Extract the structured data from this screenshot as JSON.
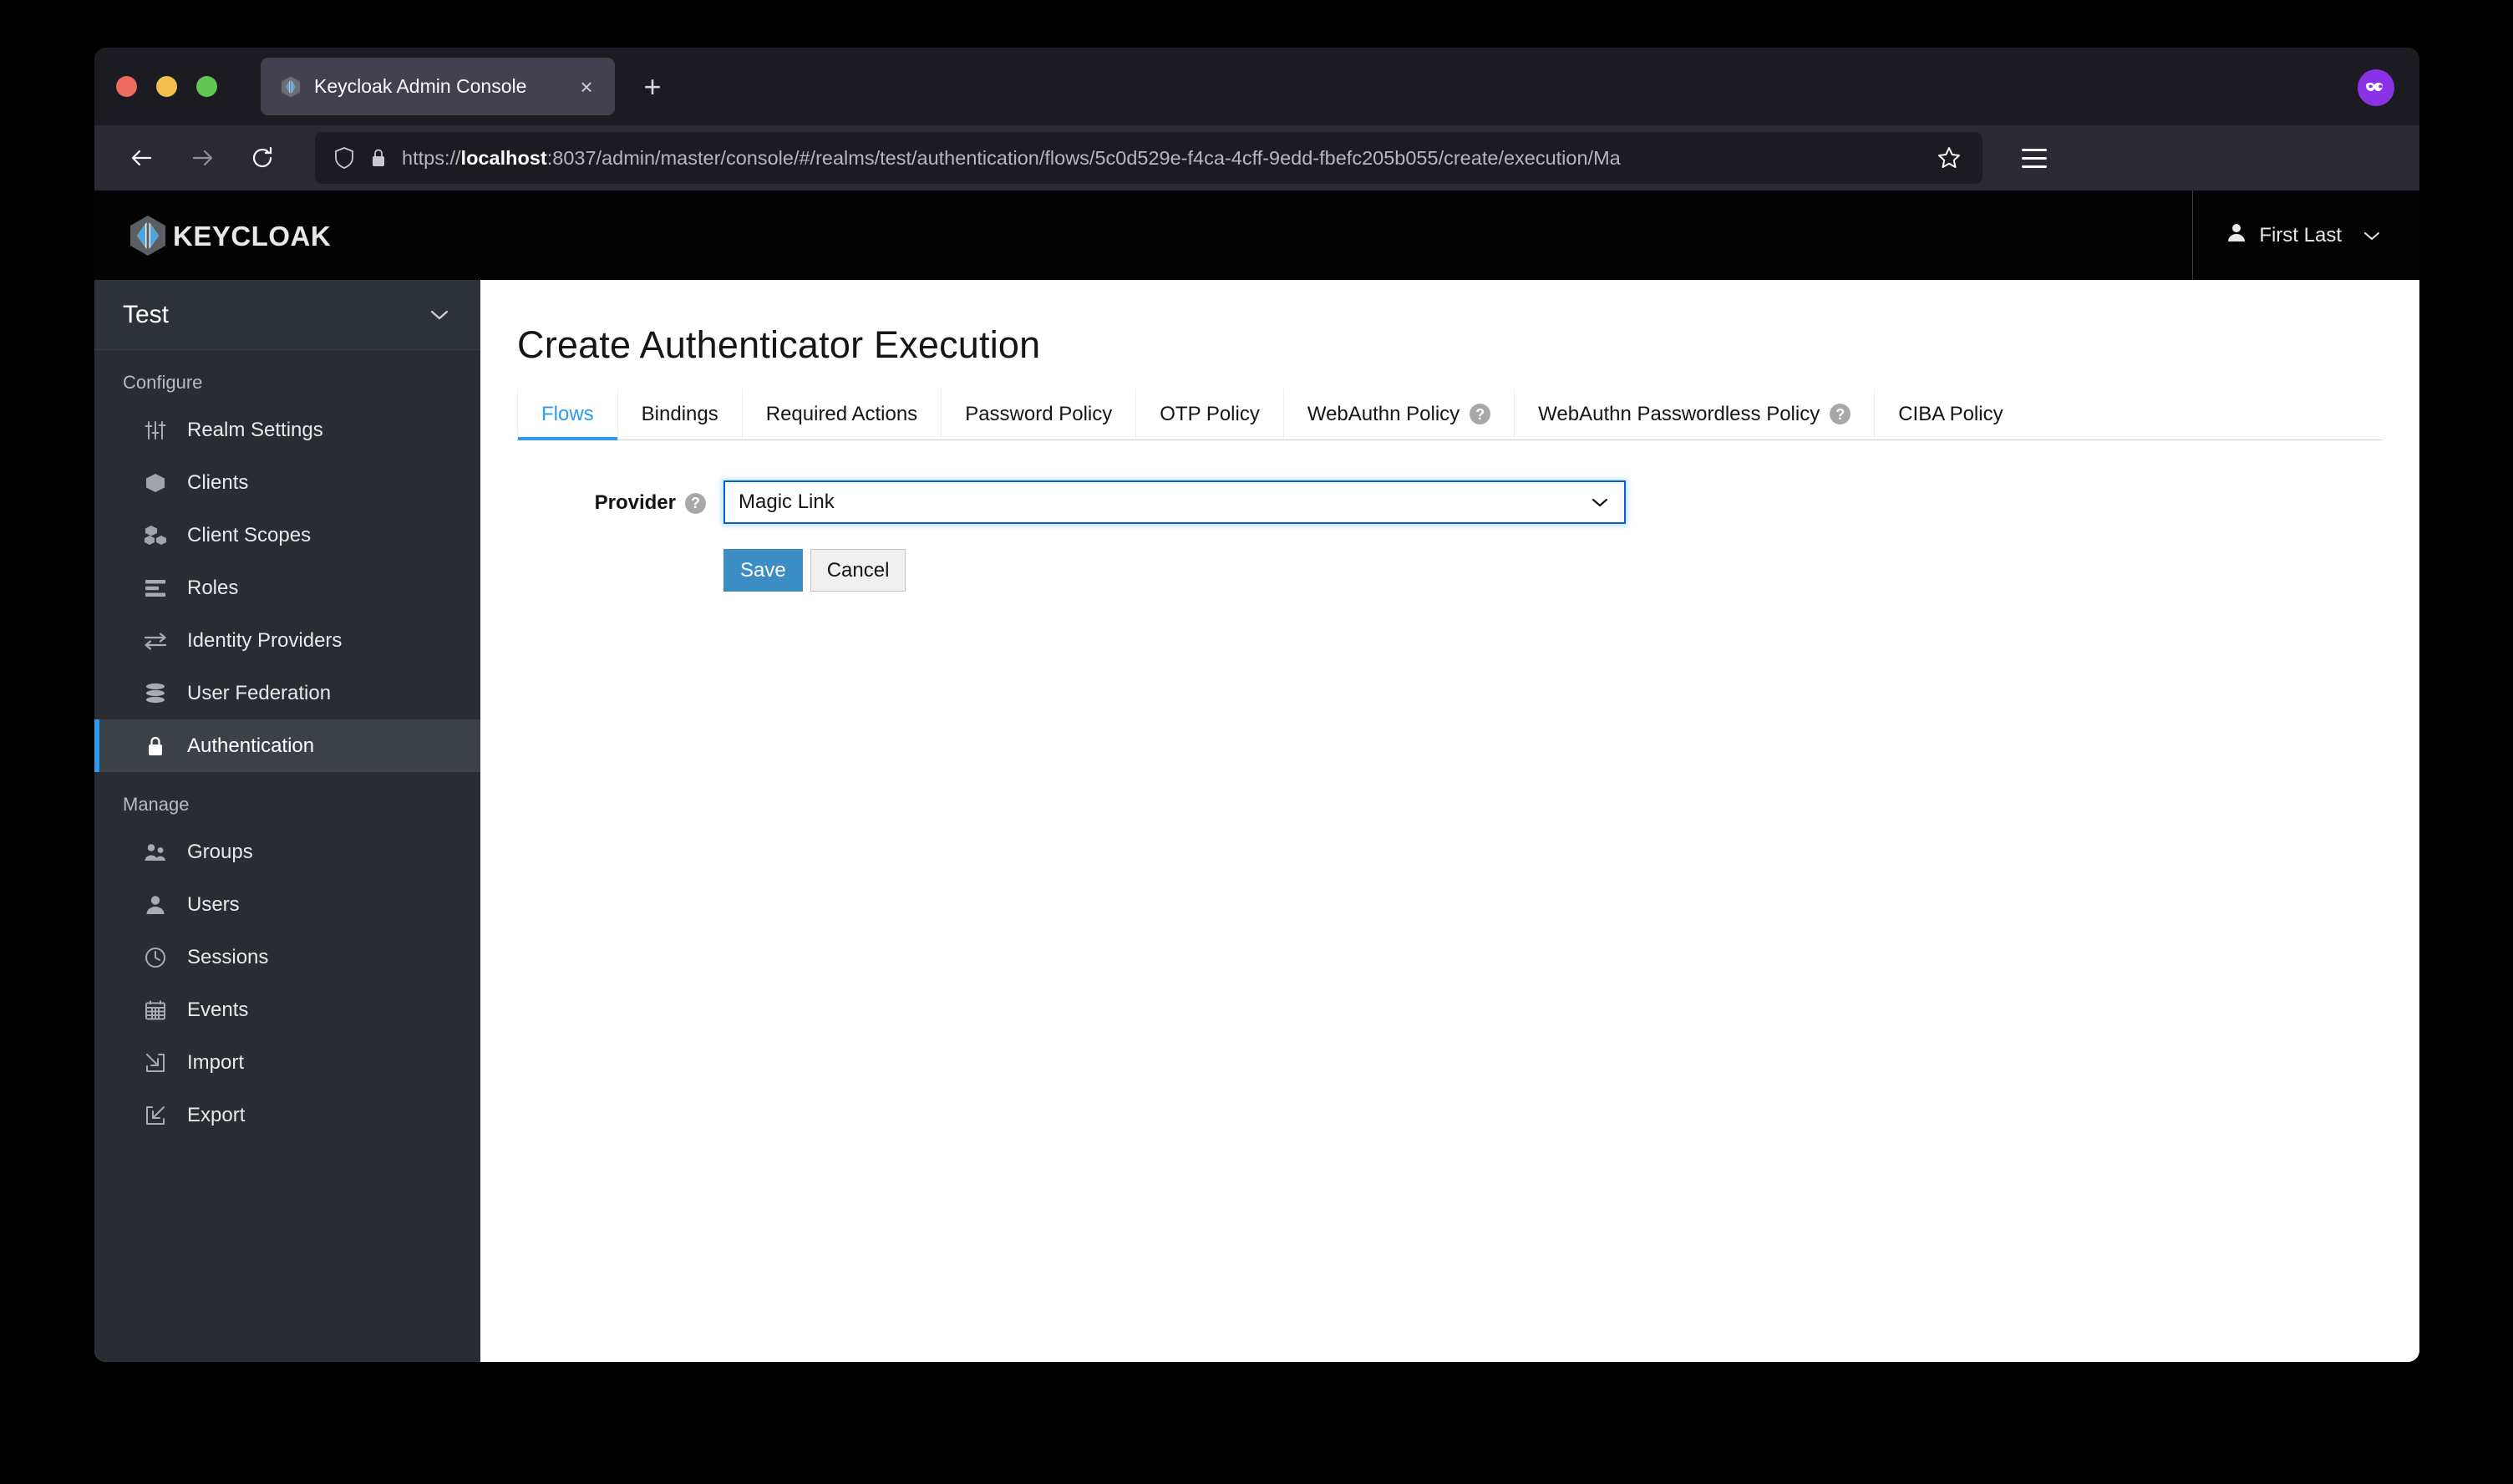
{
  "browser": {
    "tab": {
      "title": "Keycloak Admin Console",
      "favicon": "keycloak-favicon",
      "close_label": "×"
    },
    "new_tab_label": "+",
    "private_badge": "private-browsing-mask",
    "url": {
      "scheme": "https://",
      "host": "localhost",
      "rest": ":8037/admin/master/console/#/realms/test/authentication/flows/5c0d529e-f4ca-4cff-9edd-fbefc205b055/create/execution/Ma",
      "full": "https://localhost:8037/admin/master/console/#/realms/test/authentication/flows/5c0d529e-f4ca-4cff-9edd-fbefc205b055/create/execution/Ma"
    },
    "back_label": "Back",
    "forward_label": "Forward",
    "reload_label": "Reload",
    "bookmark_label": "Bookmark this page",
    "menu_label": "Open application menu"
  },
  "masthead": {
    "brand": "KEYCLOAK",
    "user": {
      "name": "First Last",
      "icon": "user-icon",
      "chevron": "chevron-down-icon"
    }
  },
  "sidebar": {
    "realm": {
      "name": "Test",
      "chevron": "chevron-down-icon"
    },
    "sections": [
      {
        "title": "Configure",
        "items": [
          {
            "label": "Realm Settings",
            "icon": "sliders-icon",
            "active": false
          },
          {
            "label": "Clients",
            "icon": "cube-icon",
            "active": false
          },
          {
            "label": "Client Scopes",
            "icon": "cubes-icon",
            "active": false
          },
          {
            "label": "Roles",
            "icon": "list-icon",
            "active": false
          },
          {
            "label": "Identity Providers",
            "icon": "exchange-icon",
            "active": false
          },
          {
            "label": "User Federation",
            "icon": "database-icon",
            "active": false
          },
          {
            "label": "Authentication",
            "icon": "lock-icon",
            "active": true
          }
        ]
      },
      {
        "title": "Manage",
        "items": [
          {
            "label": "Groups",
            "icon": "users-icon",
            "active": false
          },
          {
            "label": "Users",
            "icon": "user-icon",
            "active": false
          },
          {
            "label": "Sessions",
            "icon": "clock-icon",
            "active": false
          },
          {
            "label": "Events",
            "icon": "calendar-icon",
            "active": false
          },
          {
            "label": "Import",
            "icon": "import-icon",
            "active": false
          },
          {
            "label": "Export",
            "icon": "export-icon",
            "active": false
          }
        ]
      }
    ]
  },
  "main": {
    "title": "Create Authenticator Execution",
    "tabs": [
      {
        "label": "Flows",
        "active": true,
        "help": false
      },
      {
        "label": "Bindings",
        "active": false,
        "help": false
      },
      {
        "label": "Required Actions",
        "active": false,
        "help": false
      },
      {
        "label": "Password Policy",
        "active": false,
        "help": false
      },
      {
        "label": "OTP Policy",
        "active": false,
        "help": false
      },
      {
        "label": "WebAuthn Policy",
        "active": false,
        "help": true
      },
      {
        "label": "WebAuthn Passwordless Policy",
        "active": false,
        "help": true
      },
      {
        "label": "CIBA Policy",
        "active": false,
        "help": false
      }
    ],
    "form": {
      "provider_label": "Provider",
      "provider_help": "?",
      "provider_value": "Magic Link",
      "provider_chevron": "chevron-down-icon",
      "save_label": "Save",
      "cancel_label": "Cancel"
    }
  },
  "colors": {
    "accent_blue": "#2b9af3",
    "primary_button": "#3c8dc4",
    "focus_border": "#0066cc",
    "sidebar_bg": "#292d33",
    "masthead_bg": "#030303",
    "private_purple": "#8a33e6"
  }
}
